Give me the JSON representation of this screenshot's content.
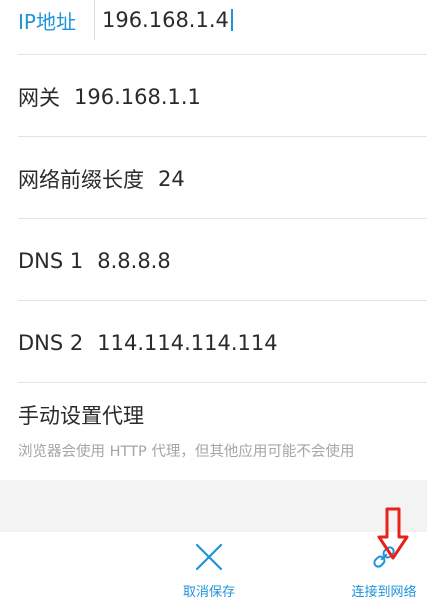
{
  "fields": {
    "ip": {
      "label": "IP地址",
      "value": "196.168.1.4"
    },
    "gateway": {
      "label": "网关",
      "value": "196.168.1.1"
    },
    "prefix": {
      "label": "网络前缀长度",
      "value": "24"
    },
    "dns1": {
      "label": "DNS 1",
      "value": "8.8.8.8"
    },
    "dns2": {
      "label": "DNS 2",
      "value": "114.114.114.114"
    }
  },
  "proxy": {
    "title": "手动设置代理",
    "description": "浏览器会使用 HTTP 代理，但其他应用可能不会使用"
  },
  "actions": {
    "cancel": {
      "label": "取消保存",
      "icon": "close-icon"
    },
    "connect": {
      "label": "连接到网络",
      "icon": "link-icon"
    }
  },
  "colors": {
    "accent": "#1f93d9",
    "annotation": "#e8221b",
    "text": "#2a2a2a",
    "hint": "#a5a5a5"
  }
}
